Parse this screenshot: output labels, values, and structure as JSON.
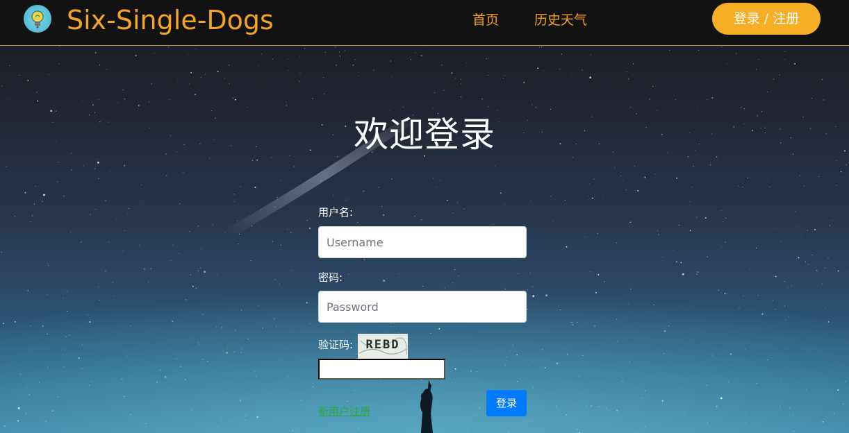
{
  "navbar": {
    "brand": "Six-Single-Dogs",
    "logo_icon": "lightbulb-logo-icon",
    "links": [
      {
        "label": "首页"
      },
      {
        "label": "历史天气"
      }
    ],
    "login_register_label": "登录 / 注册"
  },
  "login": {
    "title": "欢迎登录",
    "username_label": "用户名:",
    "username_placeholder": "Username",
    "password_label": "密码:",
    "password_placeholder": "Password",
    "captcha_label": "验证码:",
    "captcha_text": "REBD",
    "register_link": "新用户注册",
    "submit_label": "登录"
  },
  "colors": {
    "accent": "#f3a51f",
    "navbar_bg": "#121212",
    "submit_button": "#007bff",
    "register_link": "#28a745"
  }
}
